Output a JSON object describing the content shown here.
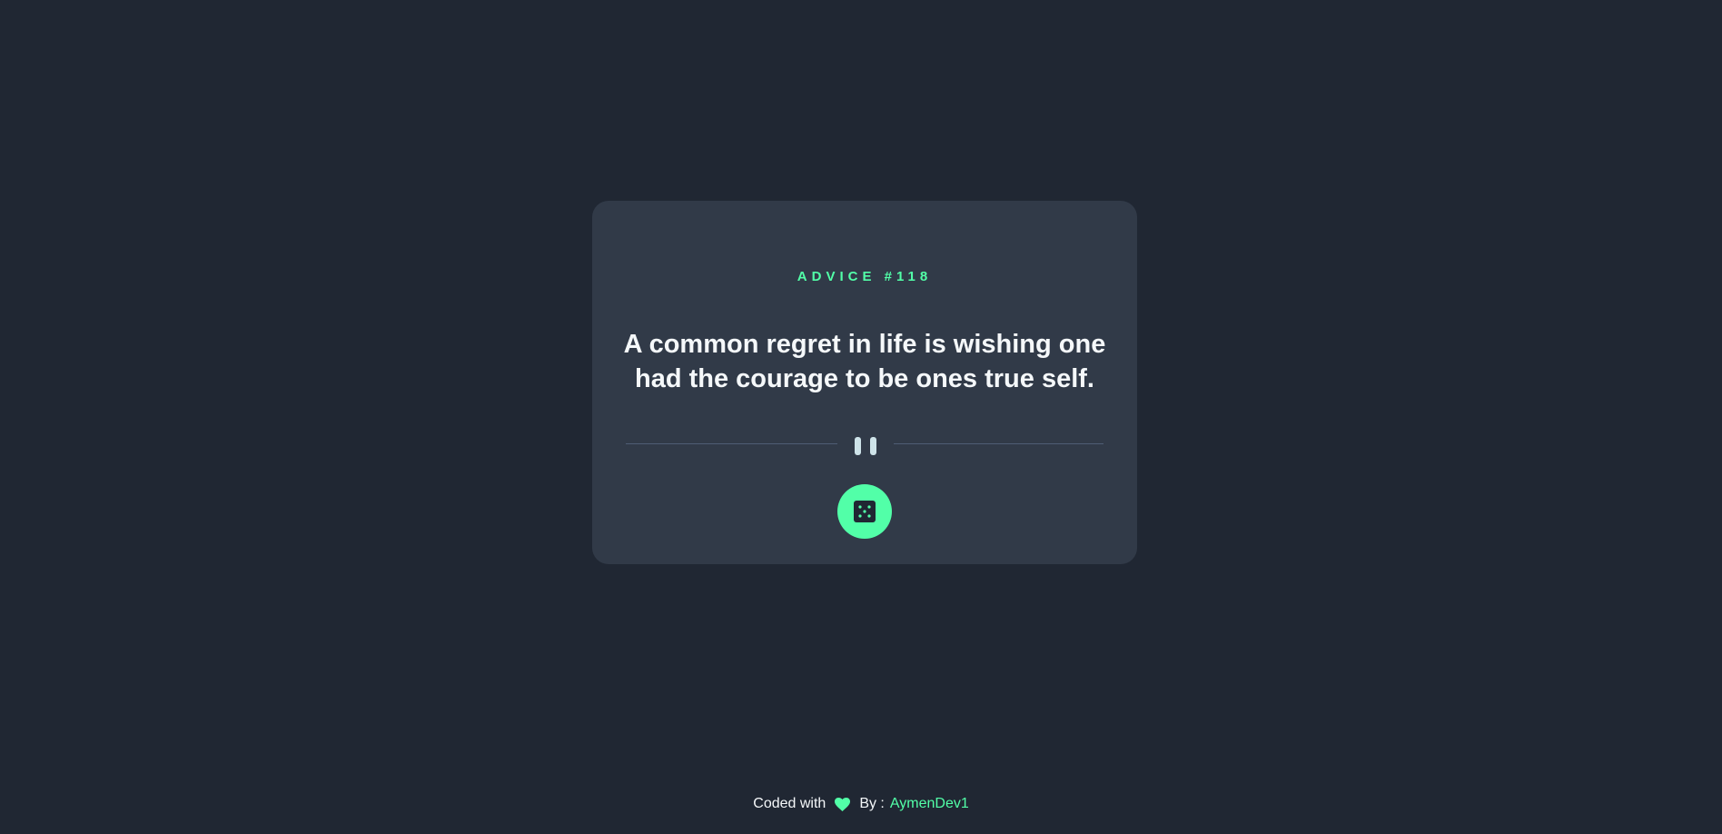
{
  "advice": {
    "label": "ADVICE #118",
    "text": "A common regret in life is wishing one had the courage to be ones true self."
  },
  "icons": {
    "divider": "pause-icon",
    "button": "dice-icon",
    "footer": "heart-icon"
  },
  "footer": {
    "prefix": "Coded with",
    "by_label": "By :",
    "author": "AymenDev1"
  },
  "colors": {
    "background": "#202733",
    "card": "#313a48",
    "accent": "#52ffa8",
    "text": "#f5f8fa",
    "muted": "#cee3e9",
    "divider": "#4f5d74"
  }
}
